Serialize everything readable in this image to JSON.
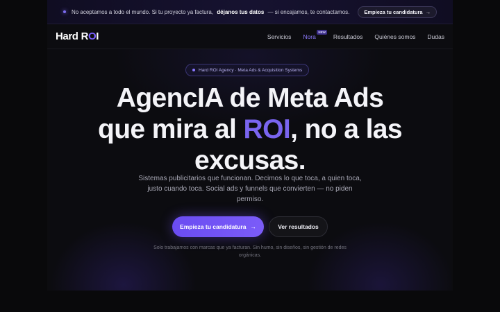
{
  "announcement": {
    "text_before": "No aceptamos a todo el mundo. Si tu proyecto ya factura,",
    "text_bold": "déjanos tus datos",
    "text_after": "— si encajamos, te contactamos.",
    "cta_label": "Empieza tu candidatura",
    "cta_arrow": "→"
  },
  "nav": {
    "logo_hard": "Hard",
    "logo_r": "R",
    "logo_o": "O",
    "logo_i": "I",
    "links": [
      "Servicios",
      "Nora",
      "Resultados",
      "Quiénes somos",
      "Dudas"
    ],
    "new_badge": "NEW"
  },
  "hero": {
    "pill": "Hard ROI Agency · Meta Ads & Acquisition Systems",
    "headline_line1": "AgencIA de Meta Ads",
    "headline_line2_a": "que mira al",
    "headline_line2_accent": "ROI",
    "headline_line2_b": ", no a las",
    "headline_line3": "excusas.",
    "subtitle": "Sistemas publicitarios que funcionan. Decimos lo que toca, a quien toca, justo cuando toca. Social ads y funnels que convierten — no piden permiso.",
    "primary_cta": "Empieza tu candidatura",
    "primary_arrow": "→",
    "secondary_cta": "Ver resultados",
    "note": "Solo trabajamos con marcas que ya facturan. Sin humo, sin diseños, sin gestión de redes orgánicas."
  },
  "colors": {
    "accent": "#7b61ff",
    "background": "#09090b"
  }
}
